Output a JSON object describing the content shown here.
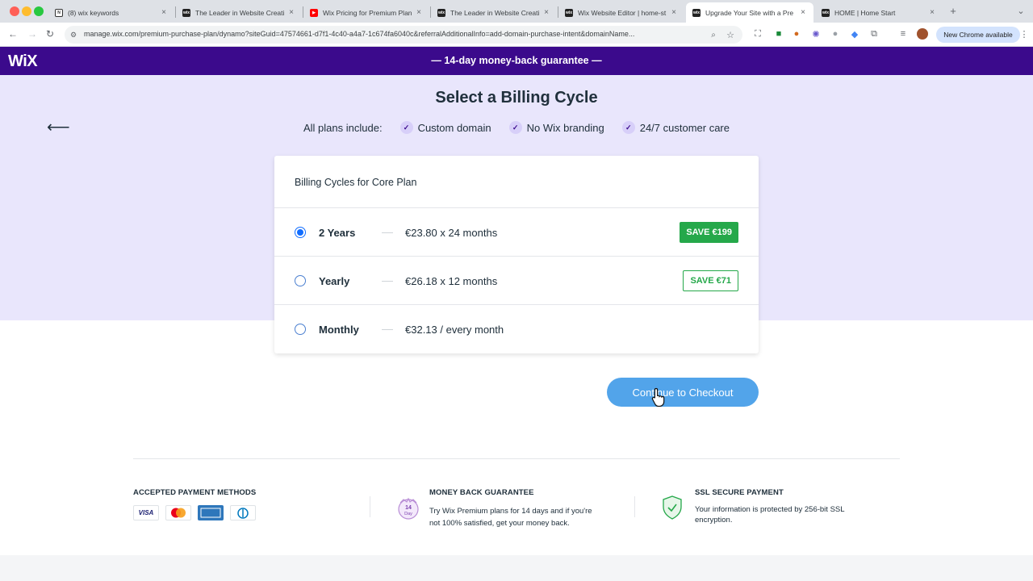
{
  "browser": {
    "tabs": [
      {
        "title": "(8) wix keywords",
        "favicon": "notion-icon"
      },
      {
        "title": "The Leader in Website Creati",
        "favicon": "wix-icon"
      },
      {
        "title": "Wix Pricing for Premium Plan",
        "favicon": "youtube-icon"
      },
      {
        "title": "The Leader in Website Creati",
        "favicon": "wix-icon"
      },
      {
        "title": "Wix Website Editor | home-st",
        "favicon": "wix-icon"
      },
      {
        "title": "Upgrade Your Site with a Pre",
        "favicon": "wix-icon",
        "active": true
      },
      {
        "title": "HOME | Home Start",
        "favicon": "wix-icon"
      }
    ],
    "url": "manage.wix.com/premium-purchase-plan/dynamo?siteGuid=47574661-d7f1-4c40-a4a7-1c674fa6040c&referralAdditionalInfo=add-domain-purchase-intent&domainName...",
    "new_chrome_label": "New Chrome available"
  },
  "header": {
    "logo": "WiX",
    "guarantee": "—  14-day money-back guarantee  —"
  },
  "main": {
    "title": "Select a Billing Cycle",
    "includes_label": "All plans include:",
    "includes": [
      "Custom domain",
      "No Wix branding",
      "24/7 customer care"
    ]
  },
  "card": {
    "title": "Billing Cycles for Core Plan",
    "options": [
      {
        "label": "2 Years",
        "price": "€23.80 x 24 months",
        "save": "SAVE €199",
        "selected": true
      },
      {
        "label": "Yearly",
        "price": "€26.18 x 12 months",
        "save": "SAVE €71",
        "selected": false
      },
      {
        "label": "Monthly",
        "price": "€32.13 / every month",
        "save": "",
        "selected": false
      }
    ]
  },
  "checkout_label": "Continue to Checkout",
  "footer": {
    "payment_title": "ACCEPTED PAYMENT METHODS",
    "payment_methods": [
      "VISA",
      "mastercard",
      "amex",
      "diners"
    ],
    "money_back_title": "MONEY BACK GUARANTEE",
    "money_back_badge": "14 Day",
    "money_back_text_1": "Try Wix Premium plans for 14 days and if you're",
    "money_back_text_2": "not 100% satisfied, get your money back.",
    "ssl_title": "SSL SECURE PAYMENT",
    "ssl_text_1": "Your information is protected by 256-bit SSL",
    "ssl_text_2": "encryption."
  },
  "colors": {
    "wix_purple": "#3b0a8c",
    "hero_bg": "#e9e6fc",
    "save_green": "#25a84a",
    "checkout_blue": "#52a4ea",
    "radio_blue": "#116dff"
  }
}
